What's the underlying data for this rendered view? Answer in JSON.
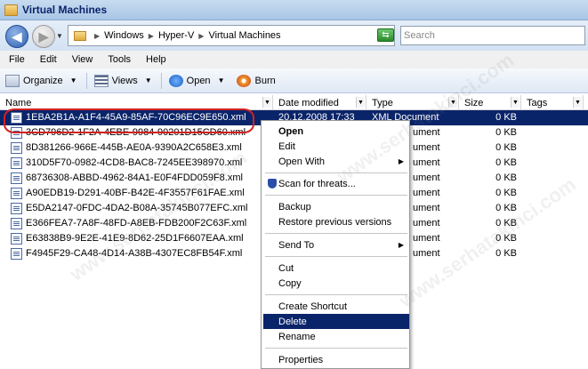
{
  "window": {
    "title": "Virtual Machines"
  },
  "nav": {
    "breadcrumbs": [
      "Windows",
      "Hyper-V",
      "Virtual Machines"
    ],
    "search_placeholder": "Search"
  },
  "menu": [
    "File",
    "Edit",
    "View",
    "Tools",
    "Help"
  ],
  "toolbar": {
    "organize": "Organize",
    "views": "Views",
    "open": "Open",
    "burn": "Burn"
  },
  "columns": {
    "name": "Name",
    "date": "Date modified",
    "type": "Type",
    "size": "Size",
    "tags": "Tags"
  },
  "files": [
    {
      "name": "1EBA2B1A-A1F4-45A9-85AF-70C96EC9E650.xml",
      "date": "20.12.2008 17:33",
      "type": "XML Document",
      "size": "0 KB",
      "selected": true
    },
    {
      "name": "3CD796D2-1F2A-4EBE-9984-90201D15CD60.xml",
      "date": "",
      "type": "ument",
      "size": "0 KB"
    },
    {
      "name": "8D381266-966E-445B-AE0A-9390A2C658E3.xml",
      "date": "",
      "type": "ument",
      "size": "0 KB"
    },
    {
      "name": "310D5F70-0982-4CD8-BAC8-7245EE398970.xml",
      "date": "",
      "type": "ument",
      "size": "0 KB"
    },
    {
      "name": "68736308-ABBD-4962-84A1-E0F4FDD059F8.xml",
      "date": "",
      "type": "ument",
      "size": "0 KB"
    },
    {
      "name": "A90EDB19-D291-40BF-B42E-4F3557F61FAE.xml",
      "date": "",
      "type": "ument",
      "size": "0 KB"
    },
    {
      "name": "E5DA2147-0FDC-4DA2-B08A-35745B077EFC.xml",
      "date": "",
      "type": "ument",
      "size": "0 KB"
    },
    {
      "name": "E366FEA7-7A8F-48FD-A8EB-FDB200F2C63F.xml",
      "date": "",
      "type": "ument",
      "size": "0 KB"
    },
    {
      "name": "E63838B9-9E2E-41E9-8D62-25D1F6607EAA.xml",
      "date": "",
      "type": "ument",
      "size": "0 KB"
    },
    {
      "name": "F4945F29-CA48-4D14-A38B-4307EC8FB54F.xml",
      "date": "",
      "type": "ument",
      "size": "0 KB"
    }
  ],
  "context_menu": {
    "open": "Open",
    "edit": "Edit",
    "open_with": "Open With",
    "scan": "Scan for threats...",
    "backup": "Backup",
    "restore": "Restore previous versions",
    "send_to": "Send To",
    "cut": "Cut",
    "copy": "Copy",
    "create_shortcut": "Create Shortcut",
    "delete": "Delete",
    "rename": "Rename",
    "properties": "Properties"
  },
  "watermark": "www.serhatakinci.com"
}
